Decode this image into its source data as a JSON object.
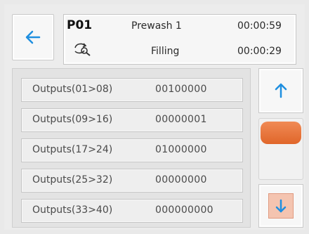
{
  "header": {
    "program_code": "P01",
    "step_name": "Prewash 1",
    "step_time": "00:00:59",
    "state": "Filling",
    "state_time": "00:00:29"
  },
  "outputs": [
    {
      "label": "Outputs(01>08)",
      "value": "00100000"
    },
    {
      "label": "Outputs(09>16)",
      "value": "00000001"
    },
    {
      "label": "Outputs(17>24)",
      "value": "01000000"
    },
    {
      "label": "Outputs(25>32)",
      "value": "00000000"
    },
    {
      "label": "Outputs(33>40)",
      "value": "000000000"
    }
  ],
  "icons": {
    "back": "arrow-left-icon",
    "cycle": "cycle-search-icon",
    "up": "arrow-up-icon",
    "down": "arrow-down-icon"
  },
  "colors": {
    "accent_blue": "#1f8fe0",
    "scroll_thumb": "#e8743a"
  },
  "scroll_position": 0.0
}
